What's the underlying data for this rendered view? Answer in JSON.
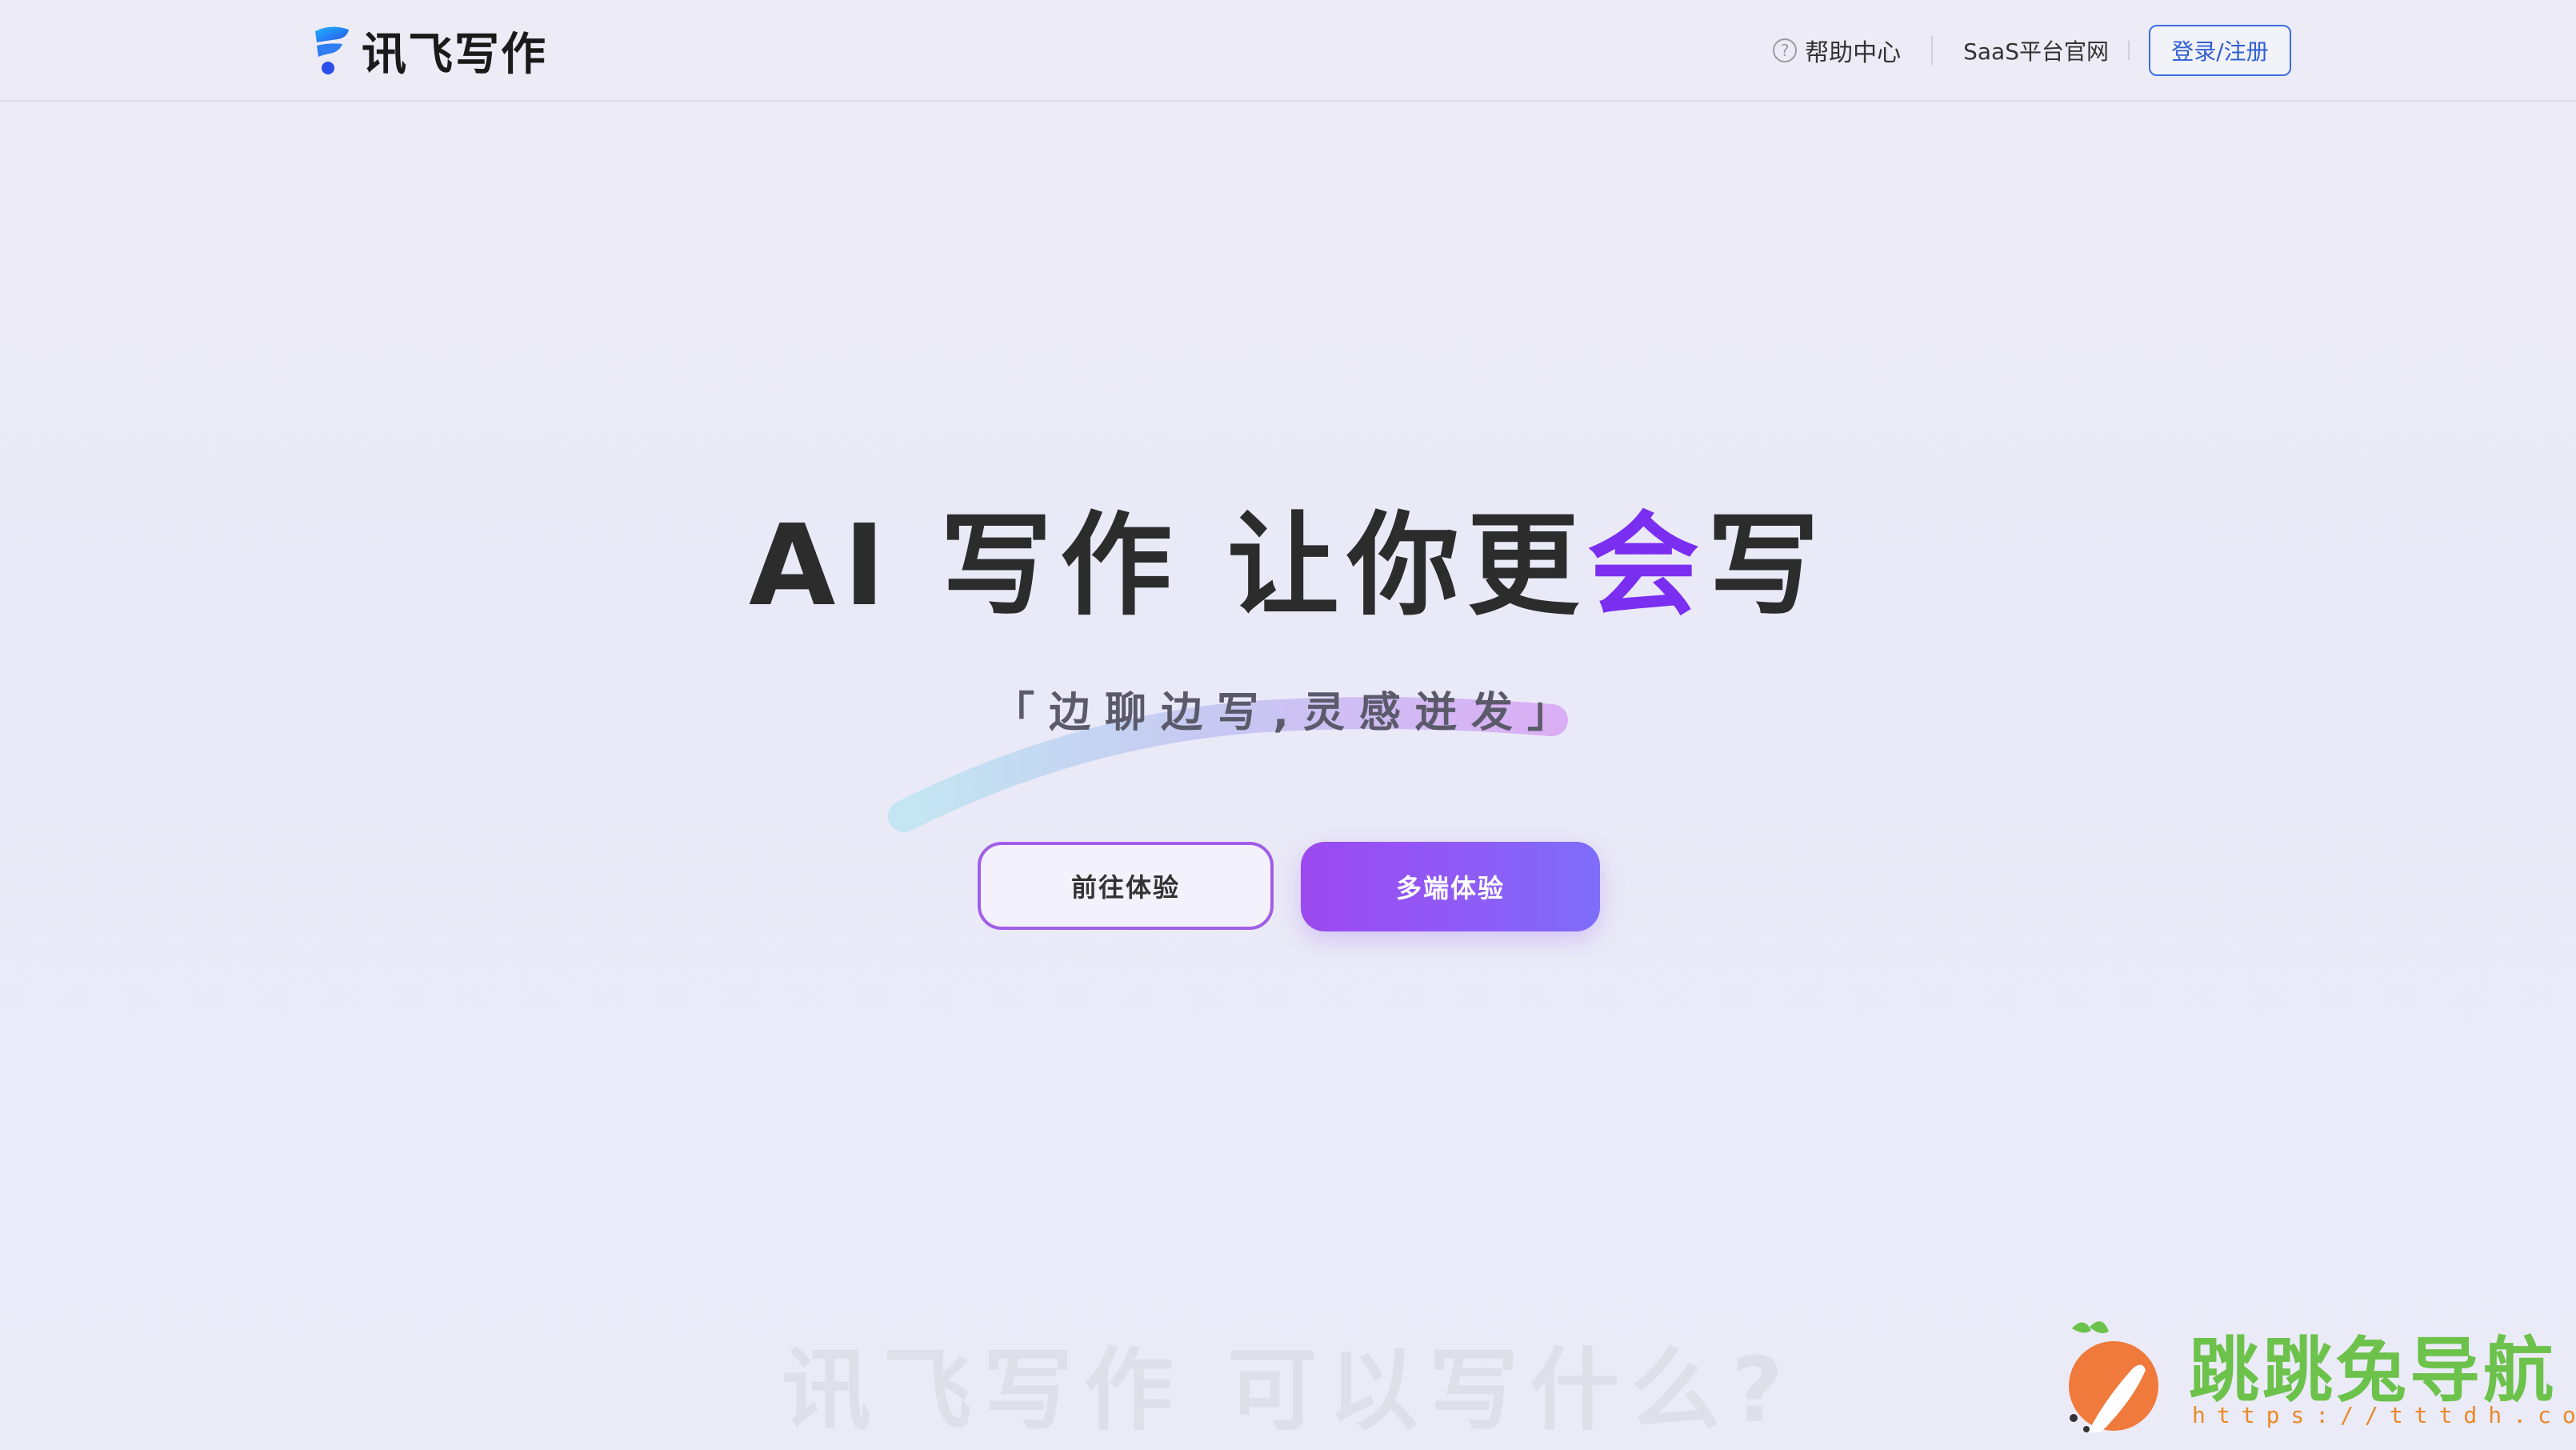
{
  "header": {
    "logo_text": "讯飞写作",
    "help_label": "帮助中心",
    "help_icon_glyph": "?",
    "saas_label": "SaaS平台官网",
    "login_label": "登录/注册"
  },
  "hero": {
    "title_part1": "AI 写作 让你更",
    "title_accent": "会",
    "title_part2": "写",
    "tagline": "「边聊边写,灵感迸发」",
    "btn_try": "前往体验",
    "btn_multi": "多端体验"
  },
  "section": {
    "next_title": "讯飞写作 可以写什么?"
  },
  "watermark": {
    "text": "跳跳兔导航",
    "url": "https://tttdh.com"
  },
  "colors": {
    "accent": "#7a2ef0",
    "login_border": "#3a6fe0",
    "button_gradient_start": "#9b49ee",
    "button_gradient_end": "#7e6dfb"
  }
}
